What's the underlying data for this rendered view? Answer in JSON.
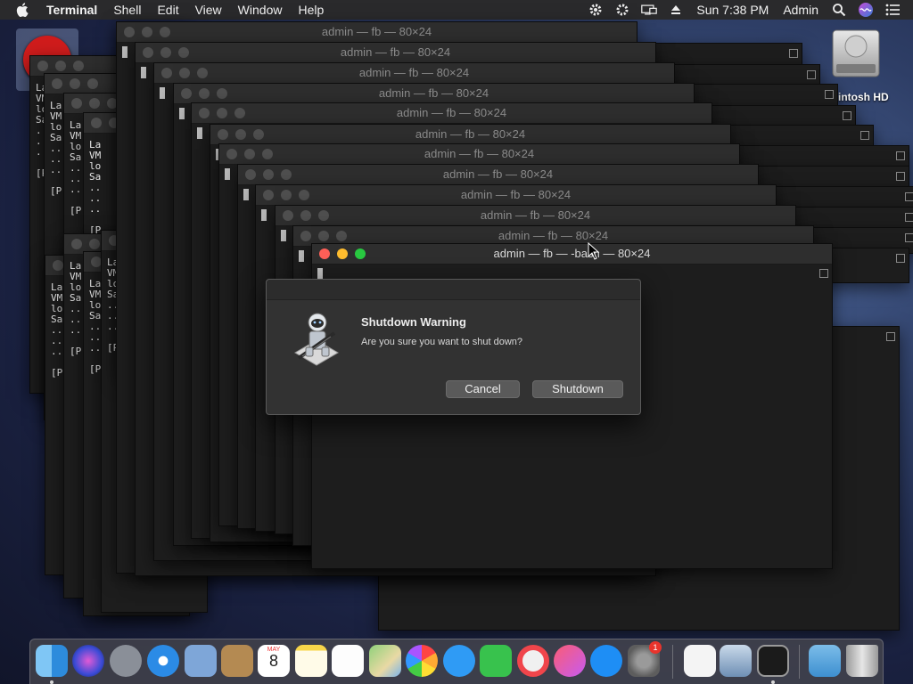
{
  "menubar": {
    "app": "Terminal",
    "menus": [
      "Shell",
      "Edit",
      "View",
      "Window",
      "Help"
    ],
    "clock": "Sun 7:38 PM",
    "user": "Admin",
    "status_icons": [
      "gear-icon",
      "gear-icon",
      "display-icon",
      "eject-icon",
      "search-icon",
      "siri-icon",
      "list-icon"
    ]
  },
  "desktop": {
    "hd_label": "intosh HD"
  },
  "terminal": {
    "back_title": "admin — fb — 80×24",
    "front_title": "admin — fb — -bash — 80×24",
    "side_text": "La\nVM\nlo\nSa\n..\n..\n..\n\n[P"
  },
  "dialog": {
    "title": "Shutdown Warning",
    "message": "Are you sure you want to shut down?",
    "cancel": "Cancel",
    "confirm": "Shutdown"
  },
  "dock": {
    "calendar_month": "MAY",
    "calendar_day": "8",
    "appstore_badge": "1",
    "items": [
      "finder",
      "siri",
      "launchpad",
      "safari",
      "mail",
      "contacts",
      "calendar",
      "notes",
      "reminders",
      "maps",
      "photos",
      "messages",
      "facetime",
      "news",
      "itunes",
      "app-store",
      "system-preferences",
      "textedit",
      "preview",
      "terminal",
      "downloads",
      "trash"
    ]
  }
}
